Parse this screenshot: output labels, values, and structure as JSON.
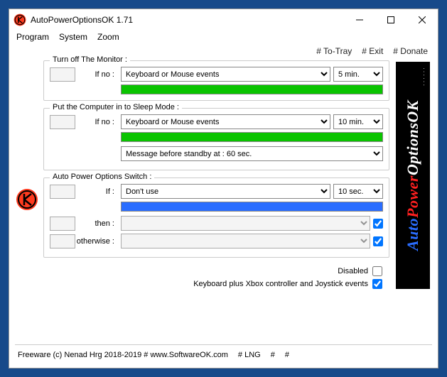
{
  "window": {
    "title": "AutoPowerOptionsOK 1.71"
  },
  "menu": {
    "program": "Program",
    "system": "System",
    "zoom": "Zoom"
  },
  "hash": {
    "totray": "# To-Tray",
    "exit": "# Exit",
    "donate": "# Donate"
  },
  "group1": {
    "title": "Turn off The Monitor :",
    "ifno": "If no :",
    "event": "Keyboard or Mouse events",
    "time": "5 min."
  },
  "group2": {
    "title": "Put the Computer in to Sleep Mode :",
    "ifno": "If no :",
    "event": "Keyboard or Mouse events",
    "time": "10 min.",
    "msg": "Message before standby at : 60 sec."
  },
  "group3": {
    "title": "Auto Power Options Switch :",
    "if": "If :",
    "dontuse": "Don't use",
    "time": "10 sec.",
    "then": "then :",
    "otherwise": "otherwise :"
  },
  "checks": {
    "disabled": "Disabled",
    "kbxbox": "Keyboard plus Xbox controller and Joystick events"
  },
  "footer": {
    "text": "Freeware (c) Nenad Hrg 2018-2019 # www.SoftwareOK.com",
    "lng": "# LNG",
    "h1": "#",
    "h2": "#"
  },
  "banner": {
    "auto": "Auto",
    "power": "Power",
    "options": "Options",
    "ok": "OK"
  }
}
